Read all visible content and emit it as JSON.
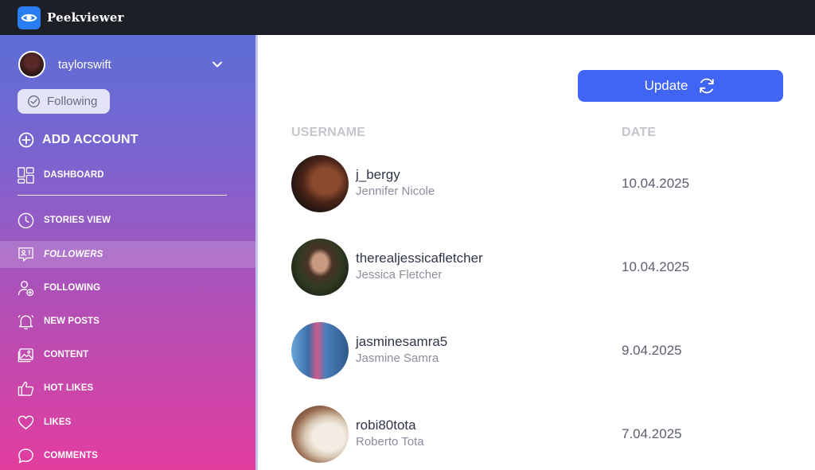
{
  "app": {
    "title": "Peekviewer",
    "accent": "#4065f5",
    "logo_icon": "eye-icon"
  },
  "account": {
    "username": "taylorswift",
    "following_label": "Following"
  },
  "add_account_label": "ADD ACCOUNT",
  "nav": [
    {
      "label": "DASHBOARD",
      "icon": "dashboard-icon"
    },
    {
      "label": "STORIES VIEW",
      "icon": "clock-icon"
    },
    {
      "label": "FOLLOWERS",
      "icon": "followers-icon",
      "active": true
    },
    {
      "label": "FOLLOWING",
      "icon": "user-add-icon"
    },
    {
      "label": "NEW POSTS",
      "icon": "bell-icon"
    },
    {
      "label": "CONTENT",
      "icon": "image-icon"
    },
    {
      "label": "HOT LIKES",
      "icon": "thumbs-up-icon"
    },
    {
      "label": "LIKES",
      "icon": "heart-icon"
    },
    {
      "label": "COMMENTS",
      "icon": "comment-icon"
    }
  ],
  "main": {
    "update_label": "Update",
    "columns": {
      "username": "USERNAME",
      "date": "DATE"
    },
    "rows": [
      {
        "username": "j_bergy",
        "full_name": "Jennifer Nicole",
        "date": "10.04.2025"
      },
      {
        "username": "therealjessicafletcher",
        "full_name": "Jessica Fletcher",
        "date": "10.04.2025"
      },
      {
        "username": "jasminesamra5",
        "full_name": "Jasmine Samra",
        "date": "9.04.2025"
      },
      {
        "username": "robi80tota",
        "full_name": "Roberto Tota",
        "date": "7.04.2025"
      }
    ]
  }
}
